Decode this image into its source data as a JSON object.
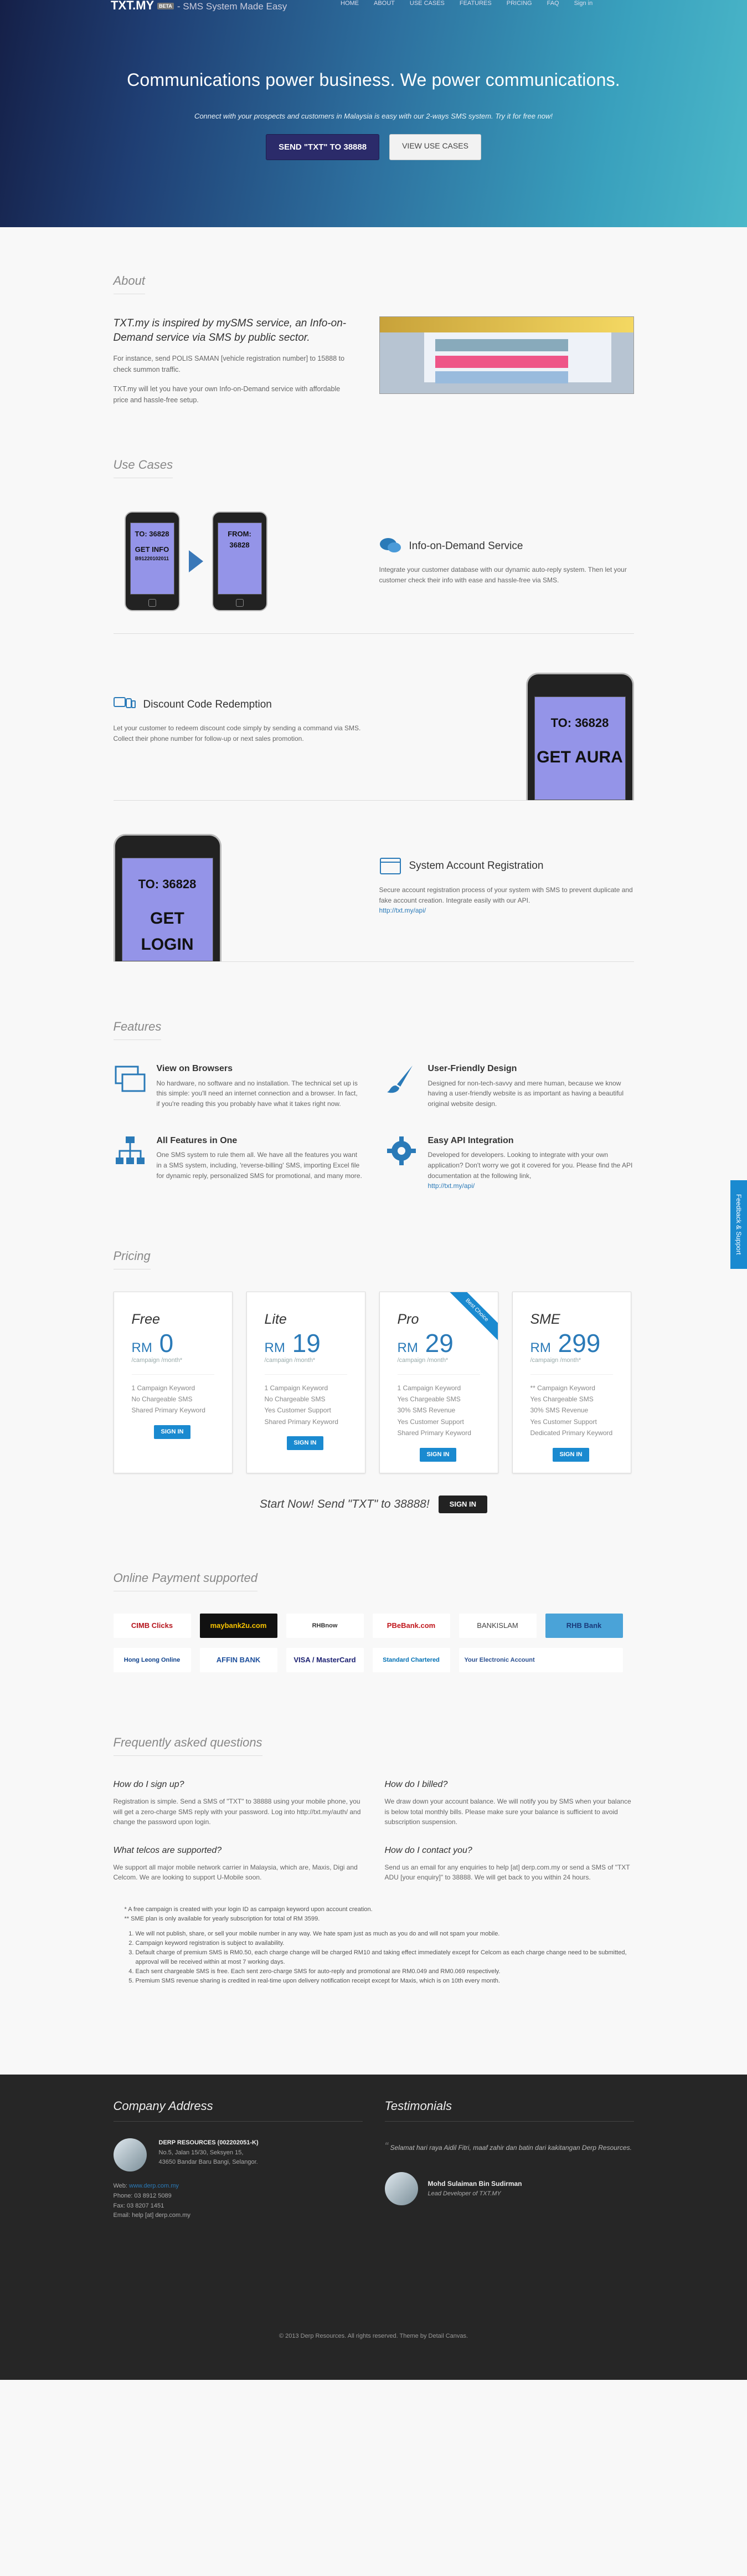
{
  "nav": {
    "brand": "TXT.MY",
    "beta": "BETA",
    "tagline": "- SMS System Made Easy",
    "items": [
      "HOME",
      "ABOUT",
      "USE CASES",
      "FEATURES",
      "PRICING",
      "FAQ",
      "Sign in"
    ]
  },
  "hero": {
    "title": "Communications power business. We power communications.",
    "subtitle": "Connect with your prospects and customers in Malaysia is easy with our 2-ways SMS system. Try it for free now!",
    "cta_primary": "SEND \"TXT\" TO 38888",
    "cta_secondary": "VIEW USE CASES"
  },
  "about": {
    "heading": "About",
    "lead": "TXT.my is inspired by mySMS service, an Info-on-Demand service via SMS by public sector.",
    "p1": "For instance, send POLIS SAMAN [vehicle registration number] to 15888 to check summon traffic.",
    "p2": "TXT.my will let you have your own Info-on-Demand service with affordable price and hassle-free setup."
  },
  "use_cases": {
    "heading": "Use Cases",
    "phone1_line1": "TO: 36828",
    "phone1_line2": "GET INFO",
    "phone1_line3": "B91220102011",
    "phone2_line1": "FROM: 36828",
    "items": [
      {
        "title": "Info-on-Demand Service",
        "text": "Integrate your customer database with our dynamic auto-reply system. Then let your customer check their info with ease and hassle-free via SMS."
      },
      {
        "title": "Discount Code Redemption",
        "text": "Let your customer to redeem discount code simply by sending a command via SMS. Collect their phone number for follow-up or next sales promotion."
      },
      {
        "title": "System Account Registration",
        "text": "Secure account registration process of your system with SMS to prevent duplicate and fake account creation. Integrate easily with our API.",
        "link": "http://txt.my/api/"
      }
    ],
    "big_phone_aura_to": "TO: 36828",
    "big_phone_aura_msg": "GET AURA",
    "big_phone_login_to": "TO: 36828",
    "big_phone_login_msg": "GET LOGIN"
  },
  "features": {
    "heading": "Features",
    "items": [
      {
        "title": "View on Browsers",
        "text": "No hardware, no software and no installation. The technical set up is this simple: you'll need an internet connection and a browser. In fact, if you're reading this you probably have what it takes right now."
      },
      {
        "title": "User-Friendly Design",
        "text": "Designed for non-tech-savvy and mere human, because we know having a user-friendly website is as important as having a beautiful original website design."
      },
      {
        "title": "All Features in One",
        "text": "One SMS system to rule them all. We have all the features you want in a SMS system, including, 'reverse-billing' SMS, importing Excel file for dynamic reply, personalized SMS for promotional, and many more."
      },
      {
        "title": "Easy API Integration",
        "text": "Developed for developers. Looking to integrate with your own application? Don't worry we got it covered for you. Please find the API documentation at the following link,",
        "link": "http://txt.my/api/"
      }
    ]
  },
  "pricing": {
    "heading": "Pricing",
    "currency": "RM",
    "per": "/campaign /month*",
    "sign_in": "SIGN IN",
    "ribbon": "Best Choice",
    "plans": [
      {
        "name": "Free",
        "price": "0",
        "f": [
          "1 Campaign Keyword",
          "No Chargeable SMS",
          "Shared Primary Keyword"
        ]
      },
      {
        "name": "Lite",
        "price": "19",
        "f": [
          "1 Campaign Keyword",
          "No Chargeable SMS",
          "Yes Customer Support",
          "Shared Primary Keyword"
        ]
      },
      {
        "name": "Pro",
        "price": "29",
        "f": [
          "1 Campaign Keyword",
          "Yes Chargeable SMS",
          "30% SMS Revenue",
          "Yes Customer Support",
          "Shared Primary Keyword"
        ]
      },
      {
        "name": "SME",
        "price": "299",
        "f": [
          "** Campaign Keyword",
          "Yes Chargeable SMS",
          "30% SMS Revenue",
          "Yes Customer Support",
          "Dedicated Primary Keyword"
        ]
      }
    ],
    "start_text": "Start Now! Send \"TXT\" to 38888!",
    "start_button": "SIGN IN"
  },
  "payment": {
    "heading": "Online Payment supported",
    "banks": [
      "CIMB Clicks",
      "maybank2u.com",
      "RHBnow",
      "PBeBank.com",
      "BANKISLAM",
      "RHB Bank",
      "Hong Leong Online",
      "AFFIN BANK",
      "VISA / MasterCard",
      "Standard Chartered",
      "Your Electronic Account",
      ""
    ]
  },
  "faq": {
    "heading": "Frequently asked questions",
    "items": [
      {
        "q": "How do I sign up?",
        "a": "Registration is simple. Send a SMS of \"TXT\" to 38888 using your mobile phone, you will get a zero-charge SMS reply with your password. Log into http://txt.my/auth/ and change the password upon login."
      },
      {
        "q": "How do I billed?",
        "a": "We draw down your account balance. We will notify you by SMS when your balance is below total monthly bills. Please make sure your balance is sufficient to avoid subscription suspension."
      },
      {
        "q": "What telcos are supported?",
        "a": "We support all major mobile network carrier in Malaysia, which are, Maxis, Digi and Celcom. We are looking to support U-Mobile soon."
      },
      {
        "q": "How do I contact you?",
        "a": "Send us an email for any enquiries to help [at] derp.com.my or send a SMS of \"TXT ADU [your enquiry]\" to 38888. We will get back to you within 24 hours."
      }
    ],
    "note1": "* A free campaign is created with your login ID as campaign keyword upon account creation.",
    "note2": "** SME plan is only available for yearly subscription for total of RM 3599.",
    "terms": [
      "We will not publish, share, or sell your mobile number in any way. We hate spam just as much as you do and will not spam your mobile.",
      "Campaign keyword registration is subject to availability.",
      "Default charge of premium SMS is RM0.50, each charge change will be charged RM10 and taking effect immediately except for Celcom as each charge change need to be submitted, approval will be received within at most 7 working days.",
      "Each sent chargeable SMS is free. Each sent zero-charge SMS for auto-reply and promotional are RM0.049 and RM0.069 respectively.",
      "Premium SMS revenue sharing is credited in real-time upon delivery notification receipt except for Maxis, which is on 10th every month."
    ]
  },
  "footer": {
    "address_heading": "Company Address",
    "company": "DERP RESOURCES (002202051-K)",
    "addr1": "No.5, Jalan 15/30, Seksyen 15,",
    "addr2": "43650 Bandar Baru Bangi, Selangor.",
    "web_label": "Web:",
    "web": "www.derp.com.my",
    "phone": "Phone: 03 8912 5089",
    "fax": "Fax: 03 8207 1451",
    "email": "Email: help [at] derp.com.my",
    "testimonials_heading": "Testimonials",
    "quote": "Selamat hari raya Aidil Fitri, maaf zahir dan batin dari kakitangan Derp Resources.",
    "person": "Mohd Sulaiman Bin Sudirman",
    "role": "Lead Developer of TXT.MY",
    "copyright": "© 2013 Derp Resources. All rights reserved. Theme by Detail Canvas."
  },
  "feedback": "Feedback & Support"
}
